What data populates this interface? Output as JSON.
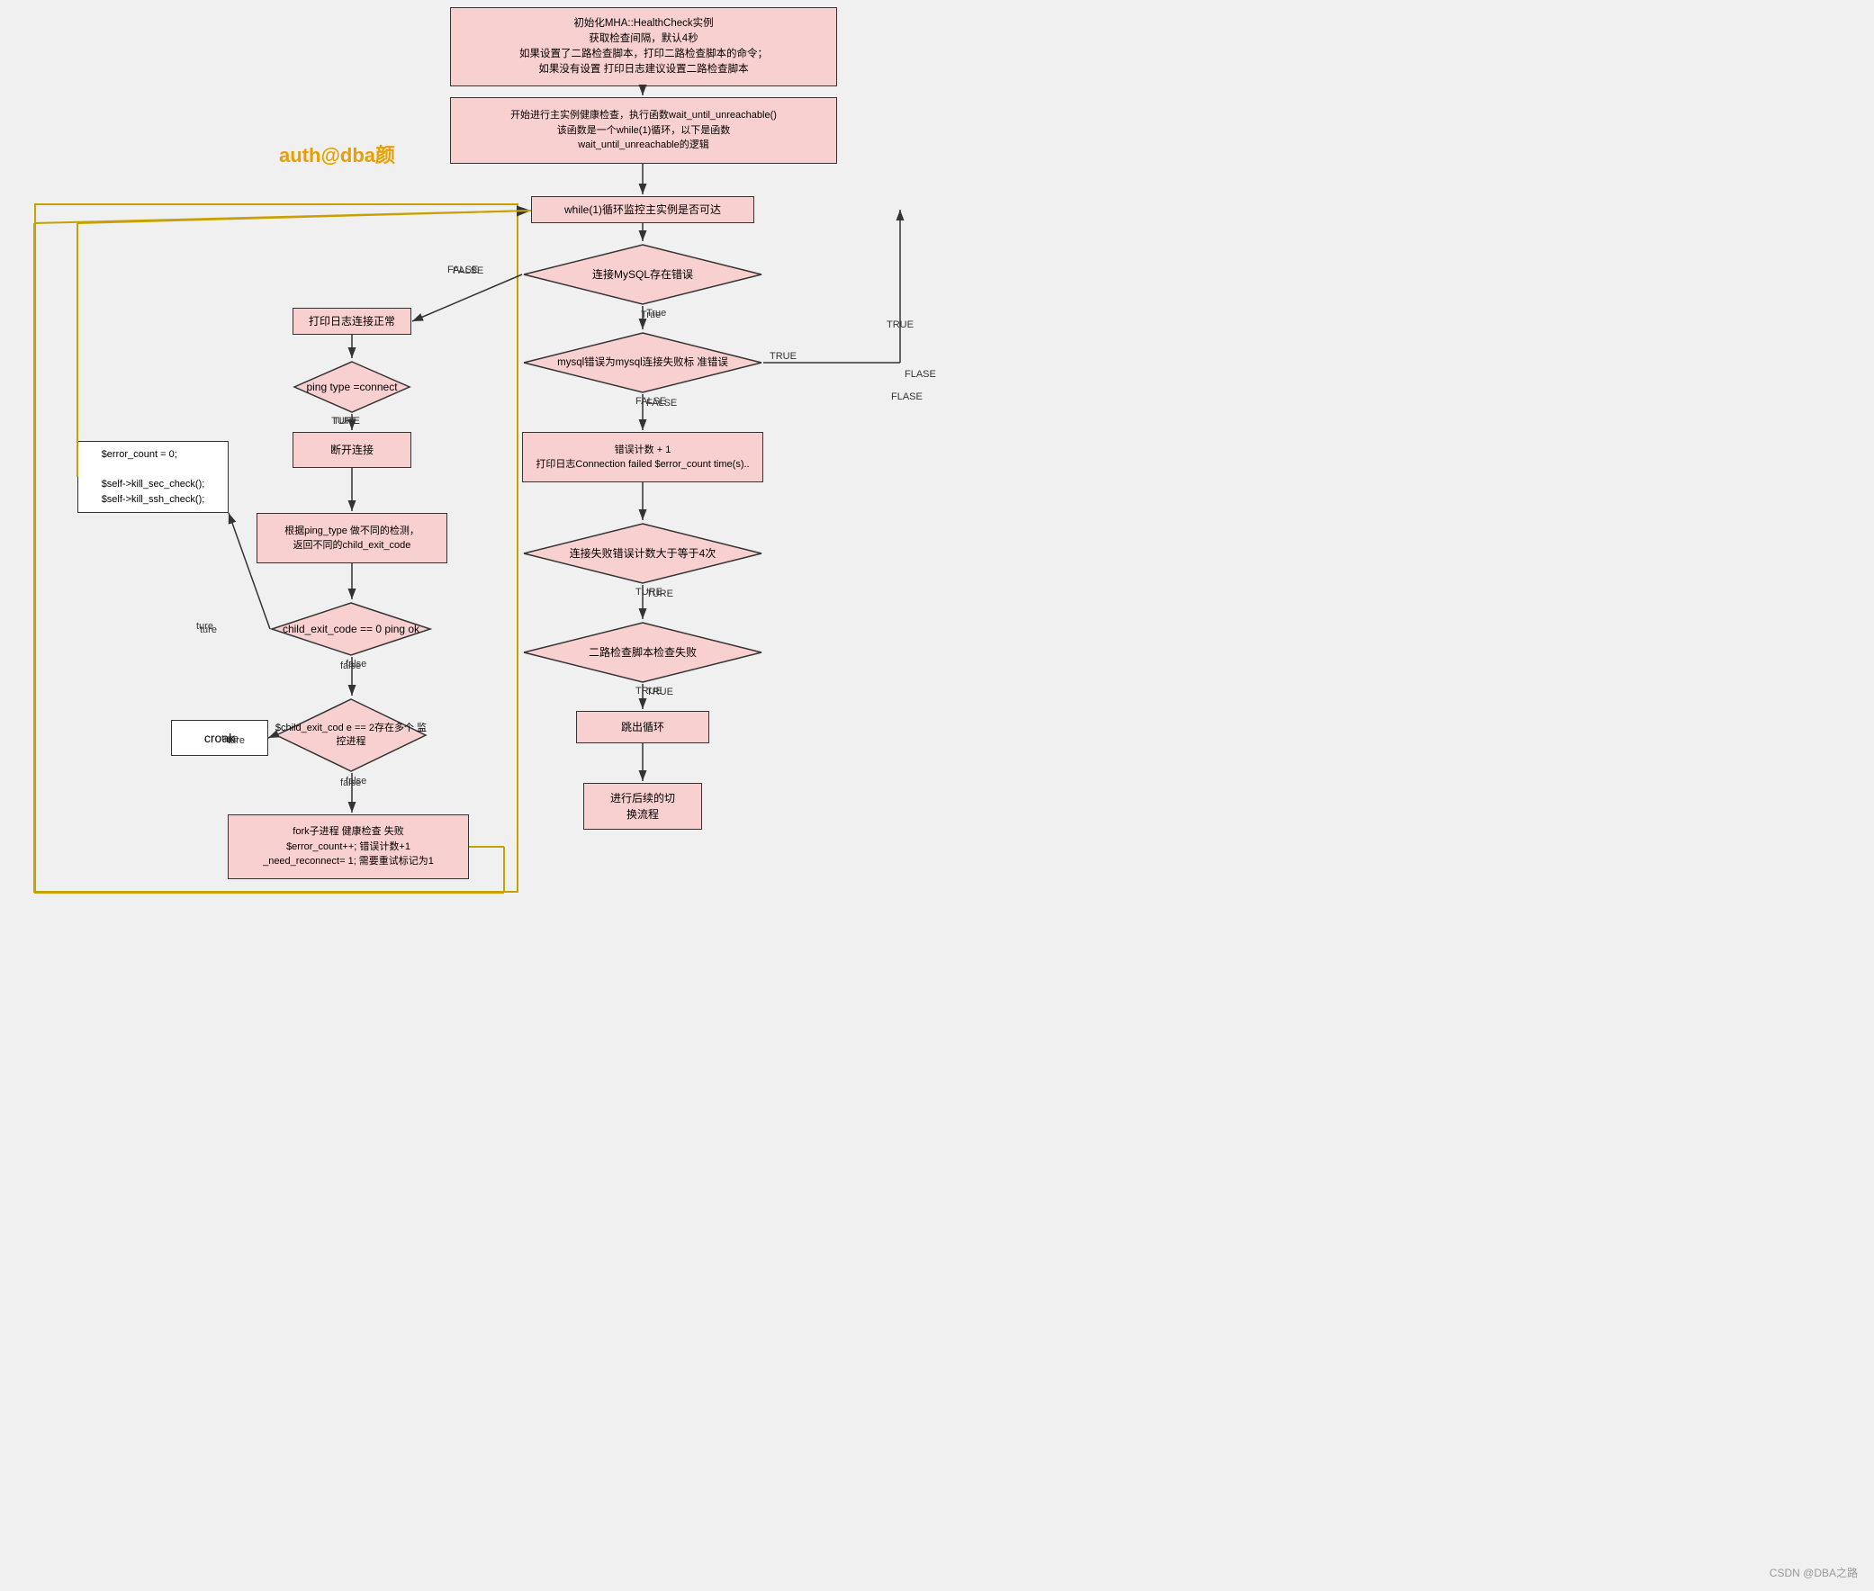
{
  "watermark": "auth@dba颜",
  "csdn": "CSDN @DBA之路",
  "boxes": {
    "init_box": {
      "text": "初始化MHA::HealthCheck实例\n获取检查间隔，默认4秒\n如果设置了二路检查脚本，打印二路检查脚本的命令；\n如果没有设置 打印日志建议设置二路检查脚本"
    },
    "main_loop_start": {
      "text": "开始进行主实例健康检查，执行函数wait_until_unreachable()\n该函数是一个while(1)循环，以下是函数\nwait_until_unreachable的逻辑"
    },
    "while_box": {
      "text": "while(1)循环监控主实例是否可达"
    },
    "print_normal": {
      "text": "打印日志连接正常"
    },
    "ping_type_box": {
      "text": "ping type\n=connect"
    },
    "disconnect_box": {
      "text": "断开连接"
    },
    "child_exit_code_box": {
      "text": "根据ping_type 做不同的检测，\n返回不同的child_exit_code"
    },
    "error_count_box": {
      "text": "$error_count = 0;\n\n$self->kill_sec_check();\n$self->kill_ssh_check();"
    },
    "fork_fail_box": {
      "text": "fork子进程 健康检查 失败\n$error_count++; 错误计数+1\n_need_reconnect= 1; 需要重试标记为1"
    },
    "croak_box": {
      "text": "croak"
    },
    "mysql_connect_error": {
      "text": "连接MySQL存在错误"
    },
    "mysql_error_std": {
      "text": "mysql错误为mysql连接失败标\n准错误"
    },
    "error_count_plus": {
      "text": "错误计数 + 1\n打印日志Connection failed $error_count time(s).."
    },
    "connect_fail_4": {
      "text": "连接失败错误计数大于等于4次"
    },
    "secondary_check": {
      "text": "二路检查脚本检查失败"
    },
    "exit_loop": {
      "text": "跳出循环"
    },
    "failover": {
      "text": "进行后续的切\n换流程"
    },
    "child_exit_code_diamond": {
      "text": "child_exit_code\n== 0 ping ok"
    },
    "child_exit_code_2": {
      "text": "$child_exit_cod\ne == 2存在多个\n监控进程"
    }
  },
  "labels": {
    "false_label": "FALSE",
    "true_label": "True",
    "true_upper": "TRUE",
    "ture_label": "TURE",
    "false_lower": "false",
    "ture_lower": "ture",
    "false_2": "FALSE",
    "true_2": "TURE",
    "flase": "FLASE",
    "true_3": "TRUE",
    "false_3": "false"
  }
}
